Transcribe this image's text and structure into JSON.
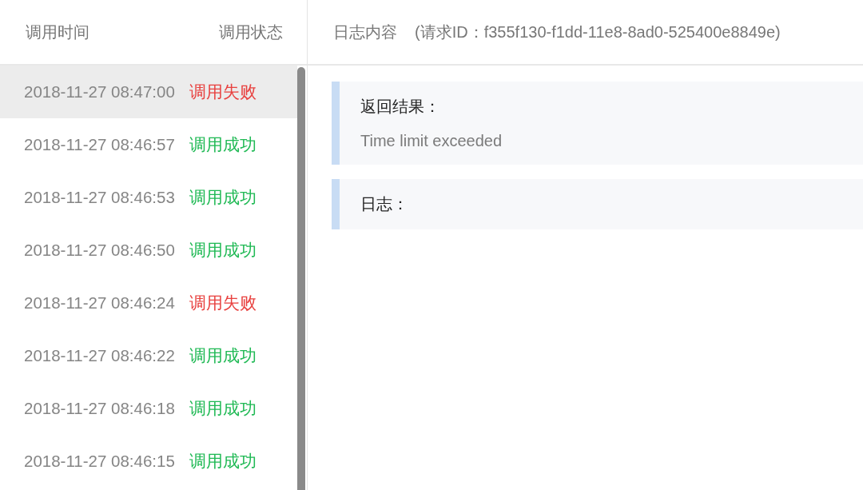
{
  "list_header": {
    "column_1": "调用时间",
    "column_2": "调用状态"
  },
  "calls": [
    {
      "time": "2018-11-27 08:47:00",
      "status": "调用失败",
      "kind": "failed",
      "selected": true
    },
    {
      "time": "2018-11-27 08:46:57",
      "status": "调用成功",
      "kind": "success",
      "selected": false
    },
    {
      "time": "2018-11-27 08:46:53",
      "status": "调用成功",
      "kind": "success",
      "selected": false
    },
    {
      "time": "2018-11-27 08:46:50",
      "status": "调用成功",
      "kind": "success",
      "selected": false
    },
    {
      "time": "2018-11-27 08:46:24",
      "status": "调用失败",
      "kind": "failed",
      "selected": false
    },
    {
      "time": "2018-11-27 08:46:22",
      "status": "调用成功",
      "kind": "success",
      "selected": false
    },
    {
      "time": "2018-11-27 08:46:18",
      "status": "调用成功",
      "kind": "success",
      "selected": false
    },
    {
      "time": "2018-11-27 08:46:15",
      "status": "调用成功",
      "kind": "success",
      "selected": false
    }
  ],
  "detail_header": {
    "title": "日志内容",
    "request_id": "(请求ID：f355f130-f1dd-11e8-8ad0-525400e8849e)"
  },
  "sections": [
    {
      "title": "返回结果：",
      "body": "Time limit exceeded"
    },
    {
      "title": "日志："
    }
  ]
}
